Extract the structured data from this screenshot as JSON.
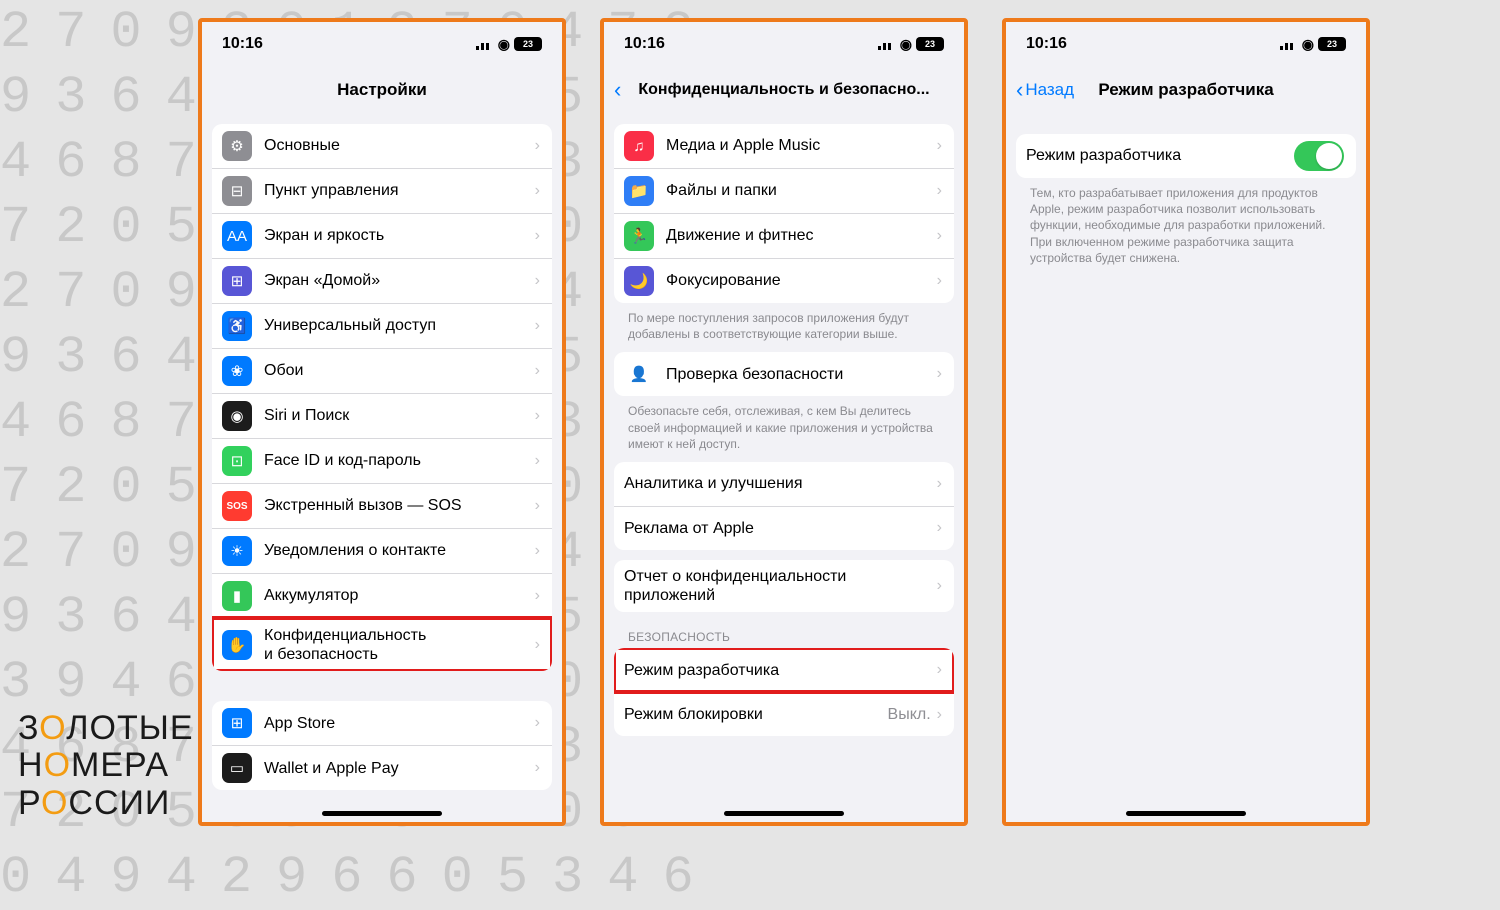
{
  "background_numbers": "2709301270472\n9364048613530\n4687296605346\n7205834871062\n2709301368472\n9364014013530\n4687296605346\n7205839371062\n2709336093472\n9364023613530\n3946186831062\n4687202005346\n7205834871062\n0494296605346",
  "brand": {
    "line1": "ЗОЛОТЫЕ",
    "line2": "НОМЕРА",
    "line3": "РОССИИ"
  },
  "status": {
    "time": "10:16",
    "battery": "23"
  },
  "screen1": {
    "title": "Настройки",
    "group1": [
      {
        "icon": "⚙",
        "cls": "ic-gray",
        "name": "general",
        "label": "Основные"
      },
      {
        "icon": "⊟",
        "cls": "ic-gray2",
        "name": "control-center",
        "label": "Пункт управления"
      },
      {
        "icon": "AA",
        "cls": "ic-blue",
        "name": "display",
        "label": "Экран и яркость"
      },
      {
        "icon": "⊞",
        "cls": "ic-indigo",
        "name": "home-screen",
        "label": "Экран «Домой»"
      },
      {
        "icon": "♿",
        "cls": "ic-blue",
        "name": "accessibility",
        "label": "Универсальный доступ"
      },
      {
        "icon": "❀",
        "cls": "ic-blue",
        "name": "wallpaper",
        "label": "Обои"
      },
      {
        "icon": "◉",
        "cls": "ic-black",
        "name": "siri",
        "label": "Siri и Поиск"
      },
      {
        "icon": "⊡",
        "cls": "ic-lime",
        "name": "faceid",
        "label": "Face ID и код-пароль"
      },
      {
        "icon": "SOS",
        "cls": "ic-redtext",
        "name": "sos",
        "label": "Экстренный вызов — SOS"
      },
      {
        "icon": "☀",
        "cls": "ic-blue",
        "name": "exposure",
        "label": "Уведомления о контакте"
      },
      {
        "icon": "▮",
        "cls": "ic-green",
        "name": "battery",
        "label": "Аккумулятор"
      },
      {
        "icon": "✋",
        "cls": "ic-blue",
        "name": "privacy",
        "label": "Конфиденциальность\nи безопасность",
        "highlight": true
      }
    ],
    "group2": [
      {
        "icon": "⊞",
        "cls": "ic-blue",
        "name": "appstore",
        "label": "App Store"
      },
      {
        "icon": "▭",
        "cls": "ic-black",
        "name": "wallet",
        "label": "Wallet и Apple Pay"
      }
    ]
  },
  "screen2": {
    "title": "Конфиденциальность и безопасно...",
    "group1": [
      {
        "icon": "♫",
        "cls": "ic-music",
        "name": "media",
        "label": "Медиа и Apple Music"
      },
      {
        "icon": "📁",
        "cls": "ic-folder",
        "name": "files",
        "label": "Файлы и папки"
      },
      {
        "icon": "🏃",
        "cls": "ic-green",
        "name": "motion",
        "label": "Движение и фитнес"
      },
      {
        "icon": "🌙",
        "cls": "ic-moon",
        "name": "focus",
        "label": "Фокусирование"
      }
    ],
    "note1": "По мере поступления запросов приложения будут добавлены в соответствующие категории выше.",
    "group2": [
      {
        "icon": "👤",
        "cls": "ic-safety",
        "name": "safety-check",
        "label": "Проверка безопасности"
      }
    ],
    "note2": "Обезопасьте себя, отслеживая, с кем Вы делитесь своей информацией и какие приложения и устройства имеют к ней доступ.",
    "group3": [
      {
        "name": "analytics",
        "label": "Аналитика и улучшения"
      },
      {
        "name": "ads",
        "label": "Реклама от Apple"
      }
    ],
    "group4": [
      {
        "name": "privacy-report",
        "label": "Отчет о конфиденциальности приложений"
      }
    ],
    "security_header": "БЕЗОПАСНОСТЬ",
    "group5": [
      {
        "name": "dev-mode",
        "label": "Режим разработчика",
        "highlight": true
      },
      {
        "name": "lockdown",
        "label": "Режим блокировки",
        "value": "Выкл."
      }
    ]
  },
  "screen3": {
    "back": "Назад",
    "title": "Режим разработчика",
    "toggle_label": "Режим разработчика",
    "note": "Тем, кто разрабатывает приложения для продуктов Apple, режим разработчика позволит использовать функции, необходимые для разработки приложений. При включенном режиме разработчика защита устройства будет снижена."
  }
}
